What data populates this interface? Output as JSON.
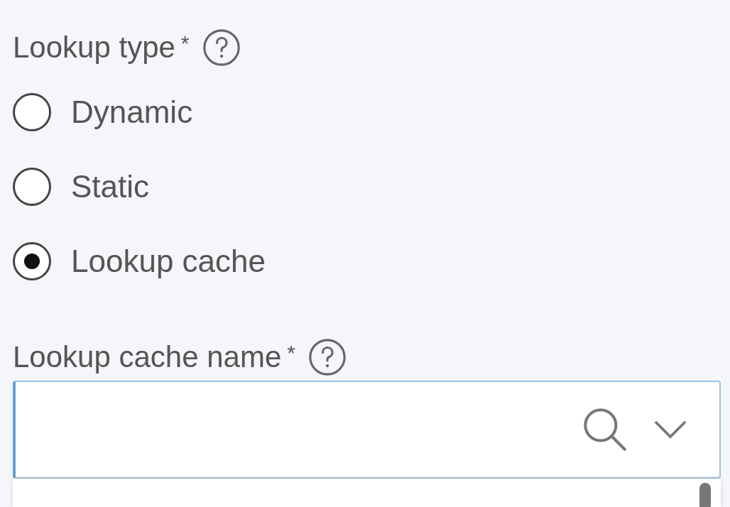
{
  "lookup_type": {
    "label": "Lookup type",
    "required_mark": "*",
    "options": [
      {
        "label": "Dynamic",
        "selected": false
      },
      {
        "label": "Static",
        "selected": false
      },
      {
        "label": "Lookup cache",
        "selected": true
      }
    ]
  },
  "lookup_cache_name": {
    "label": "Lookup cache name",
    "required_mark": "*",
    "expanded": true
  }
}
